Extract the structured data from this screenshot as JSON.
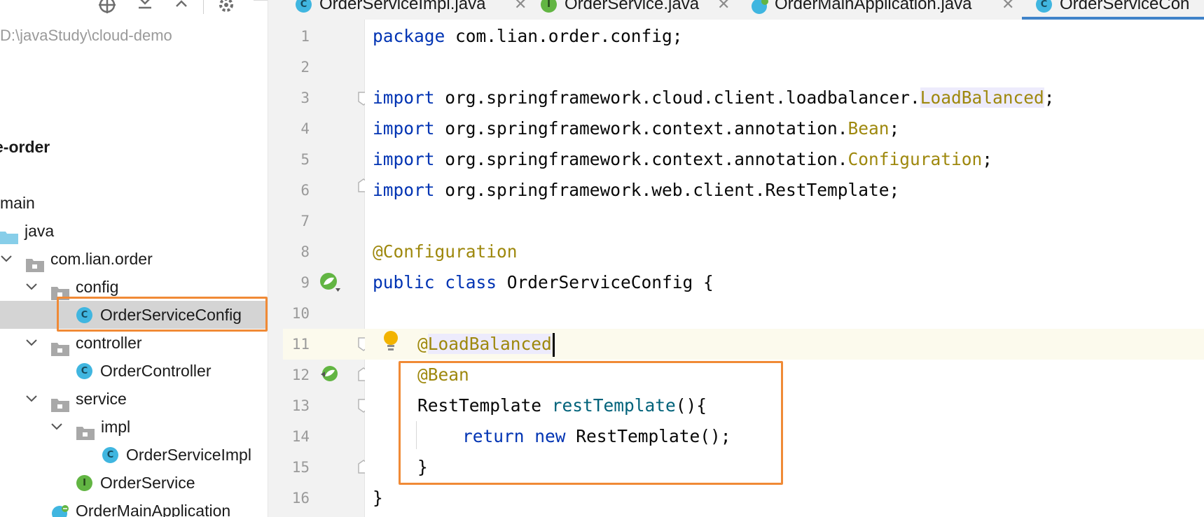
{
  "project_panel": {
    "root_path": "D:\\javaStudy\\cloud-demo",
    "tree": [
      {
        "label": "e-order",
        "kind": "module",
        "bold": true
      },
      {
        "label": "main",
        "kind": "folder-plain"
      },
      {
        "label": "java",
        "kind": "source-folder"
      },
      {
        "label": "com.lian.order",
        "kind": "package",
        "expanded": true
      },
      {
        "label": "config",
        "kind": "package",
        "expanded": true
      },
      {
        "label": "OrderServiceConfig",
        "kind": "class",
        "icon_letter": "C",
        "selected": true
      },
      {
        "label": "controller",
        "kind": "package",
        "expanded": true
      },
      {
        "label": "OrderController",
        "kind": "class",
        "icon_letter": "C"
      },
      {
        "label": "service",
        "kind": "package",
        "expanded": true
      },
      {
        "label": "impl",
        "kind": "package",
        "expanded": true
      },
      {
        "label": "OrderServiceImpl",
        "kind": "class",
        "icon_letter": "C"
      },
      {
        "label": "OrderService",
        "kind": "interface",
        "icon_letter": "I"
      },
      {
        "label": "OrderMainApplication",
        "kind": "spring-boot-class"
      }
    ]
  },
  "tabs": [
    {
      "label": "OrderServiceImpl.java",
      "icon": "class-icon",
      "icon_letter": "C",
      "closable": true
    },
    {
      "label": "OrderService.java",
      "icon": "interface-icon",
      "icon_letter": "I",
      "closable": true
    },
    {
      "label": "OrderMainApplication.java",
      "icon": "spring-boot-icon",
      "closable": true
    },
    {
      "label": "OrderServiceCon",
      "icon": "class-icon",
      "icon_letter": "C",
      "active": true
    }
  ],
  "editor": {
    "line_numbers": [
      "1",
      "2",
      "3",
      "4",
      "5",
      "6",
      "7",
      "8",
      "9",
      "10",
      "11",
      "12",
      "13",
      "14",
      "15",
      "16"
    ],
    "code": {
      "l1_kw": "package",
      "l1_rest": " com.lian.order.config;",
      "l3_kw": "import",
      "l3_pkg": " org.springframework.cloud.client.loadbalancer.",
      "l3_cls": "LoadBalanced",
      "l3_end": ";",
      "l4_kw": "import",
      "l4_pkg": " org.springframework.context.annotation.",
      "l4_cls": "Bean",
      "l4_end": ";",
      "l5_kw": "import",
      "l5_pkg": " org.springframework.context.annotation.",
      "l5_cls": "Configuration",
      "l5_end": ";",
      "l6_kw": "import",
      "l6_rest": " org.springframework.web.client.RestTemplate;",
      "l8_ann": "@Configuration",
      "l9_kw1": "public",
      "l9_kw2": "class",
      "l9_rest": " OrderServiceConfig {",
      "l11_ann_at": "@",
      "l11_ann": "LoadBalanced",
      "l12_ann": "@Bean",
      "l13_type": "RestTemplate ",
      "l13_method": "restTemplate",
      "l13_rest": "(){",
      "l14_kw1": "return",
      "l14_kw2": "new",
      "l14_rest": " RestTemplate();",
      "l15": "}",
      "l16": "}"
    }
  },
  "colors": {
    "highlight_border": "#f08a36",
    "keyword": "#0033b3",
    "annotation": "#9e880d",
    "method": "#00627a",
    "active_tab_underline": "#4083c9",
    "class_icon": "#40b6e0",
    "interface_icon": "#62b543"
  }
}
